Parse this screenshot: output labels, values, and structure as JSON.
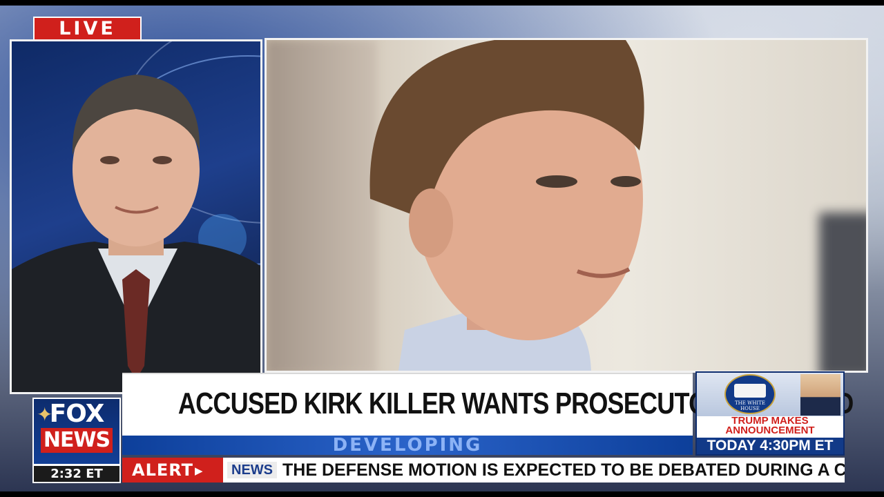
{
  "broadcast": {
    "live_label": "LIVE",
    "headline": "ACCUSED KIRK KILLER WANTS PROSECUTOR REMOVED",
    "subhead": "DEVELOPING",
    "network": {
      "fox_word": "FOX",
      "news_word": "NEWS"
    },
    "clock": "2:32 ET",
    "promo": {
      "seal_caption": "THE WHITE HOUSE",
      "headline_line1": "TRUMP MAKES",
      "headline_line2": "ANNOUNCEMENT",
      "time": "TODAY 4:30PM ET"
    },
    "ticker": {
      "alert_label": "ALERT",
      "source": "NEWS",
      "text": "THE DEFENSE MOTION IS EXPECTED TO BE DEBATED DURING A COURT HE"
    }
  },
  "colors": {
    "fox_red": "#d0201c",
    "fox_blue": "#123a88",
    "headline_text": "#111111"
  },
  "icons": {
    "arrow": "play-arrow-icon",
    "ornament": "christmas-ornament-icon"
  }
}
